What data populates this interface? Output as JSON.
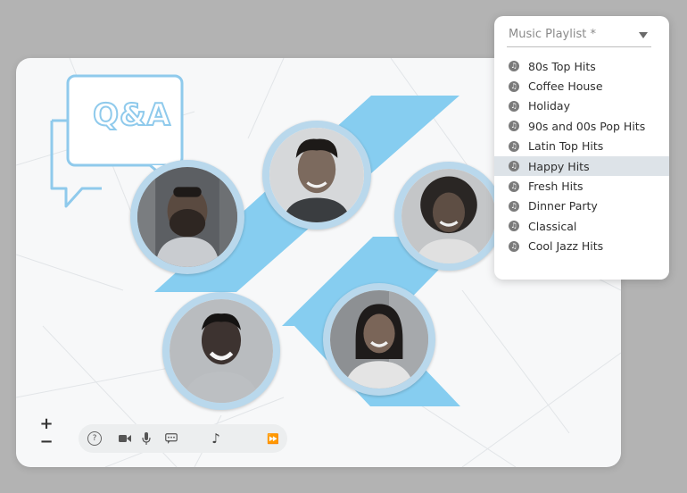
{
  "qa_badge": {
    "text": "Q&A"
  },
  "zoom": {
    "in_label": "+",
    "out_label": "−"
  },
  "toolbar": {
    "help_icon": "?",
    "music_icon": "♪",
    "forward_icon": "⏩"
  },
  "playlist": {
    "label": "Music Playlist *",
    "selected": "Happy Hits",
    "note_icon": "♫",
    "options": [
      "80s Top Hits",
      "Coffee House",
      "Holiday",
      "90s and 00s Pop Hits",
      "Latin Top Hits",
      "Happy Hits",
      "Fresh Hits",
      "Dinner Party",
      "Classical",
      "Cool Jazz Hits"
    ]
  },
  "colors": {
    "accent_stripe": "#86cdf0",
    "avatar_ring": "#b9d8ec",
    "qa_outline": "#8fcaec",
    "selected_row": "#dde3e8"
  }
}
